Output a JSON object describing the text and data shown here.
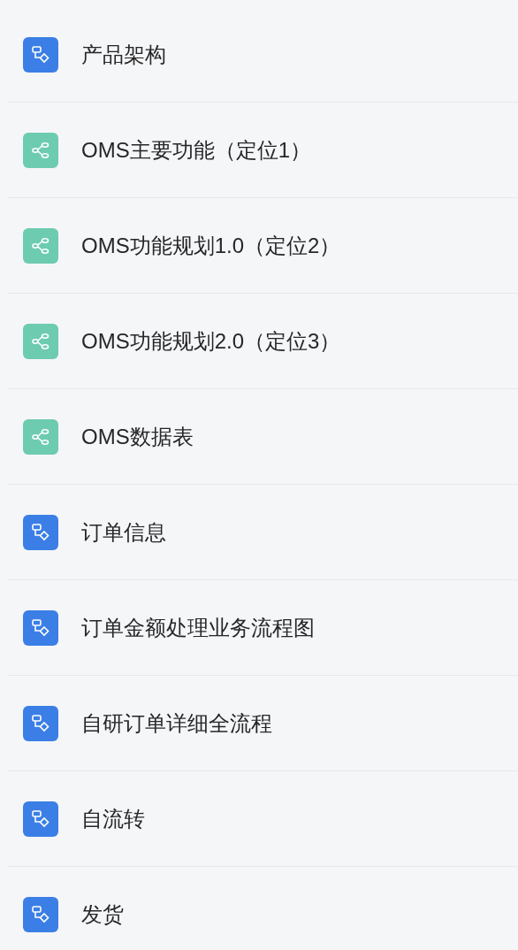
{
  "items": [
    {
      "kind": "flowchart",
      "label": "产品架构"
    },
    {
      "kind": "mindmap",
      "label": "OMS主要功能（定位1）"
    },
    {
      "kind": "mindmap",
      "label": "OMS功能规划1.0（定位2）"
    },
    {
      "kind": "mindmap",
      "label": "OMS功能规划2.0（定位3）"
    },
    {
      "kind": "mindmap",
      "label": "OMS数据表"
    },
    {
      "kind": "flowchart",
      "label": "订单信息"
    },
    {
      "kind": "flowchart",
      "label": "订单金额处理业务流程图"
    },
    {
      "kind": "flowchart",
      "label": "自研订单详细全流程"
    },
    {
      "kind": "flowchart",
      "label": "自流转"
    },
    {
      "kind": "flowchart",
      "label": "发货"
    }
  ]
}
